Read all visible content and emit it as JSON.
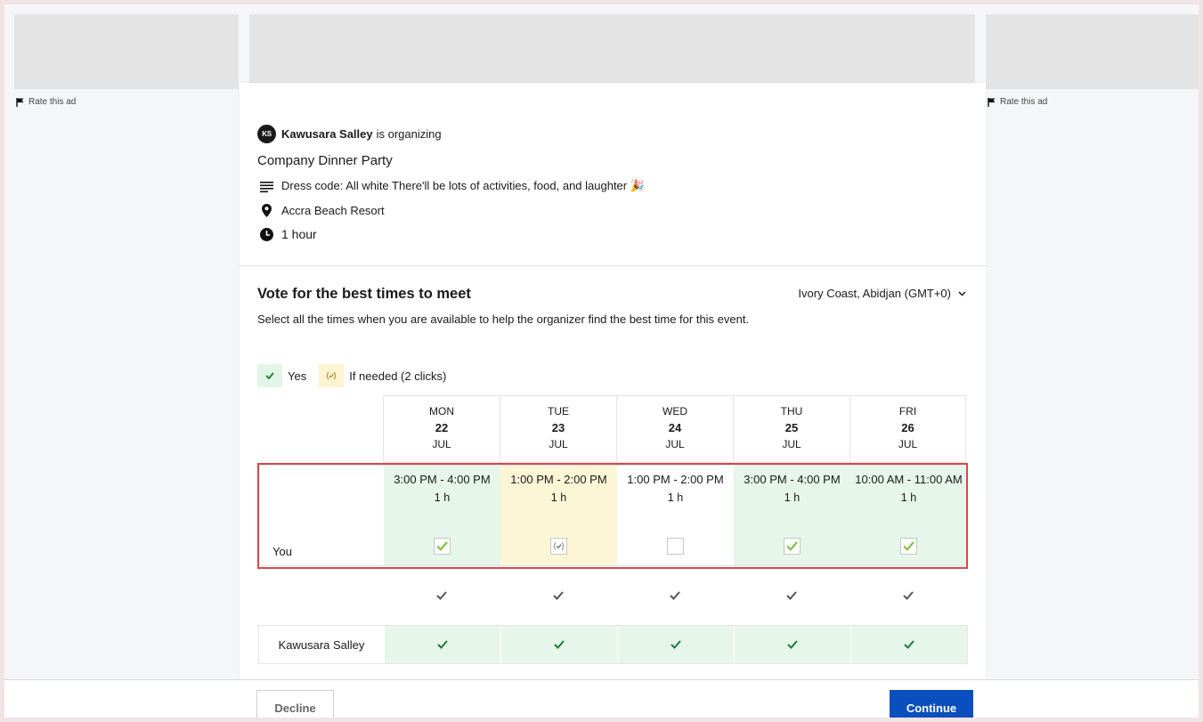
{
  "ads": {
    "rate_label_left": "Rate this ad",
    "rate_label_right": "Rate this ad"
  },
  "organizer": {
    "initials": "KS",
    "name": "Kawusara Salley",
    "suffix": "is organizing"
  },
  "event": {
    "title": "Company Dinner Party",
    "description": "Dress code: All white There'll be lots of activities, food, and laughter 🎉",
    "location": "Accra Beach Resort",
    "duration": "1 hour"
  },
  "vote": {
    "title": "Vote for the best times to meet",
    "timezone": "Ivory Coast, Abidjan (GMT+0)",
    "description": "Select all the times when you are available to help the organizer find the best time for this event."
  },
  "legend": {
    "yes": "Yes",
    "if_needed": "If needed (2 clicks)"
  },
  "days": [
    {
      "dow": "MON",
      "date": "22",
      "month": "JUL"
    },
    {
      "dow": "TUE",
      "date": "23",
      "month": "JUL"
    },
    {
      "dow": "WED",
      "date": "24",
      "month": "JUL"
    },
    {
      "dow": "THU",
      "date": "25",
      "month": "JUL"
    },
    {
      "dow": "FRI",
      "date": "26",
      "month": "JUL"
    }
  ],
  "you_row": {
    "label": "You",
    "slots": [
      {
        "time": "3:00 PM - 4:00 PM",
        "duration": "1 h",
        "state": "yes"
      },
      {
        "time": "1:00 PM - 2:00 PM",
        "duration": "1 h",
        "state": "if-needed"
      },
      {
        "time": "1:00 PM - 2:00 PM",
        "duration": "1 h",
        "state": "none"
      },
      {
        "time": "3:00 PM - 4:00 PM",
        "duration": "1 h",
        "state": "yes"
      },
      {
        "time": "10:00 AM - 11:00 AM",
        "duration": "1 h",
        "state": "yes"
      }
    ]
  },
  "participants": [
    {
      "name": "Kawusara Salley",
      "votes": [
        "yes",
        "yes",
        "yes",
        "yes",
        "yes"
      ]
    }
  ],
  "footer": {
    "decline": "Decline",
    "continue": "Continue"
  },
  "colors": {
    "yes_bg": "#e6f6ea",
    "maybe_bg": "#fdf6d6",
    "check_green": "#7cc242",
    "dark_green": "#1e7a3c",
    "primary_blue": "#0a4fbd",
    "highlight_red": "#d9474f"
  },
  "icons": {
    "description": "notes-lines-icon",
    "location": "map-pin-icon",
    "duration": "clock-icon",
    "timezone_toggle": "chevron-down-icon",
    "ad_flag": "flag-icon"
  }
}
